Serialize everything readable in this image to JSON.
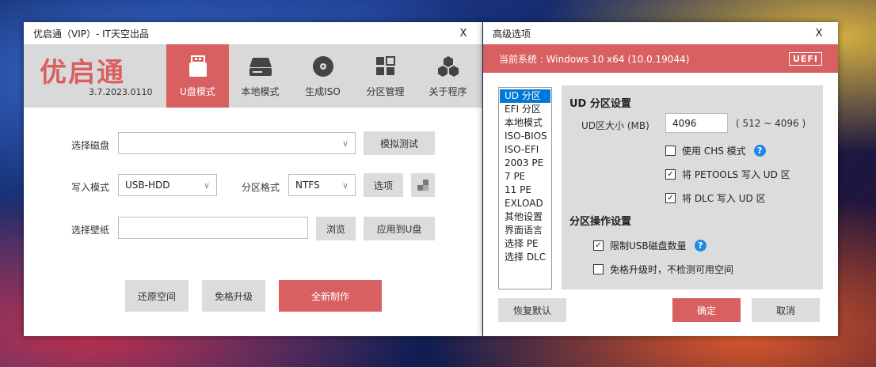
{
  "main_window": {
    "title": "优启通（VIP）- IT天空出品",
    "close": "X",
    "logo": "优启通",
    "version": "3.7.2023.0110",
    "tabs": [
      {
        "label": "U盘模式",
        "icon": "usb-drive-icon",
        "active": true
      },
      {
        "label": "本地模式",
        "icon": "hard-disk-icon"
      },
      {
        "label": "生成ISO",
        "icon": "disc-icon"
      },
      {
        "label": "分区管理",
        "icon": "partition-grid-icon"
      },
      {
        "label": "关于程序",
        "icon": "hexagon-cluster-icon"
      }
    ],
    "select_disk_label": "选择磁盘",
    "select_disk_value": "",
    "simulate_button": "模拟测试",
    "write_mode_label": "写入模式",
    "write_mode_value": "USB-HDD",
    "partition_format_label": "分区格式",
    "partition_format_value": "NTFS",
    "options_button": "选项",
    "wallpaper_label": "选择壁纸",
    "wallpaper_value": "",
    "browse_button": "浏览",
    "apply_button": "应用到U盘",
    "restore_button": "还原空间",
    "upgrade_button": "免格升级",
    "create_button": "全新制作"
  },
  "adv_window": {
    "title": "高级选项",
    "close": "X",
    "system_text": "当前系统 : Windows 10 x64 (10.0.19044)",
    "uefi_badge": "UEFI",
    "nav_items": [
      "UD 分区",
      "EFI 分区",
      "本地模式",
      "ISO-BIOS",
      "ISO-EFI",
      "2003 PE",
      "7 PE",
      "11 PE",
      "EXLOAD",
      "其他设置",
      "界面语言",
      "选择 PE",
      "选择 DLC"
    ],
    "nav_selected_index": 0,
    "ud_section_title": "UD 分区设置",
    "ud_size_label": "UD区大小 (MB)",
    "ud_size_value": "4096",
    "ud_size_range": "( 512 ~ 4096 )",
    "chs_mode_label": "使用 CHS 模式",
    "chs_mode_checked": false,
    "petools_label": "将 PETOOLS 写入 UD 区",
    "petools_checked": true,
    "dlc_label": "将 DLC 写入 UD 区",
    "dlc_checked": true,
    "partition_section_title": "分区操作设置",
    "limit_usb_label": "限制USB磁盘数量",
    "limit_usb_checked": true,
    "skip_check_label": "免格升级时，不检测可用空间",
    "skip_check_checked": false,
    "restore_default_button": "恢复默认",
    "ok_button": "确定",
    "cancel_button": "取消",
    "help_glyph": "?",
    "check_glyph": "✓"
  }
}
